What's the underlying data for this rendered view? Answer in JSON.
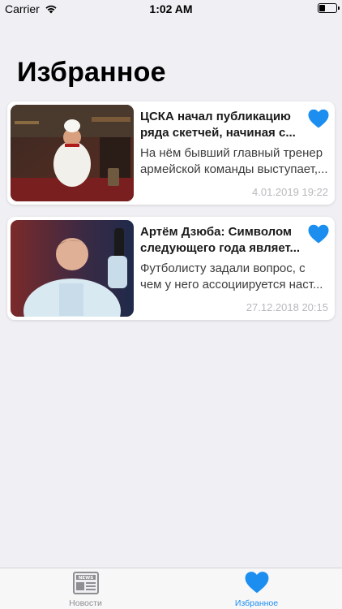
{
  "status_bar": {
    "carrier": "Carrier",
    "time": "1:02 AM"
  },
  "page": {
    "title": "Избранное"
  },
  "favorites": [
    {
      "title": "ЦСКА начал публикацию ряда скетчей, начиная с...",
      "summary": "На нём бывший главный тренер армейской команды выступает,...",
      "date": "4.01.2019 19:22",
      "favorite_icon": "heart-filled-icon"
    },
    {
      "title": "Артём Дзюба: Символом следующего года являет...",
      "summary": "Футболисту задали вопрос, с чем у него ассоциируется наст...",
      "date": "27.12.2018 20:15",
      "favorite_icon": "heart-filled-icon"
    }
  ],
  "tab_bar": {
    "tabs": [
      {
        "label": "Новости",
        "icon": "news-icon",
        "selected": false
      },
      {
        "label": "Избранное",
        "icon": "heart-icon",
        "selected": true
      }
    ]
  },
  "colors": {
    "accent": "#1b8ef0",
    "background": "#efeff4",
    "date_text": "#b9b9be"
  }
}
